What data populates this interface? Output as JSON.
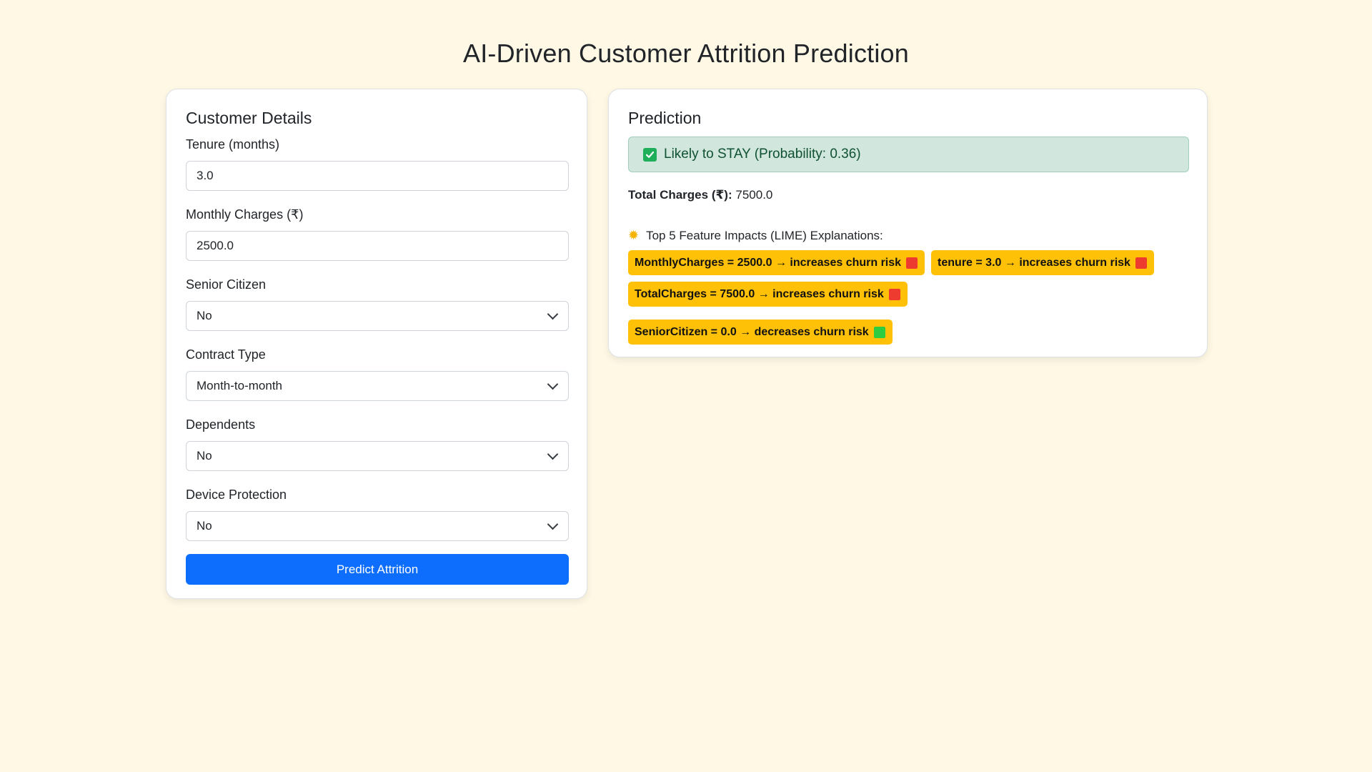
{
  "page_title": "AI-Driven Customer Attrition Prediction",
  "form": {
    "title": "Customer Details",
    "tenure": {
      "label": "Tenure (months)",
      "value": "3.0"
    },
    "monthly_charges": {
      "label": "Monthly Charges (₹)",
      "value": "2500.0"
    },
    "senior_citizen": {
      "label": "Senior Citizen",
      "selected": "No"
    },
    "contract_type": {
      "label": "Contract Type",
      "selected": "Month-to-month"
    },
    "dependents": {
      "label": "Dependents",
      "selected": "No"
    },
    "device_protection": {
      "label": "Device Protection",
      "selected": "No"
    },
    "submit_label": "Predict Attrition"
  },
  "prediction": {
    "title": "Prediction",
    "result_text": "Likely to STAY (Probability: 0.36)",
    "total_charges_label": "Total Charges (₹):",
    "total_charges_value": "7500.0",
    "explanations_title": "Top 5 Feature Impacts (LIME) Explanations:",
    "explanations": [
      {
        "text": "MonthlyCharges = 2500.0 → increases churn risk",
        "color": "#ee3b2f"
      },
      {
        "text": "tenure = 3.0 → increases churn risk",
        "color": "#ee3b2f"
      },
      {
        "text": "TotalCharges = 7500.0 → increases churn risk",
        "color": "#ee3b2f"
      },
      {
        "text": "SeniorCitizen = 0.0 → decreases churn risk",
        "color": "#2ecc40"
      }
    ]
  },
  "colors": {
    "background": "#fff8e5",
    "primary": "#0d6efd",
    "success_bg": "#d1e7dd",
    "badge": "#ffc107"
  }
}
